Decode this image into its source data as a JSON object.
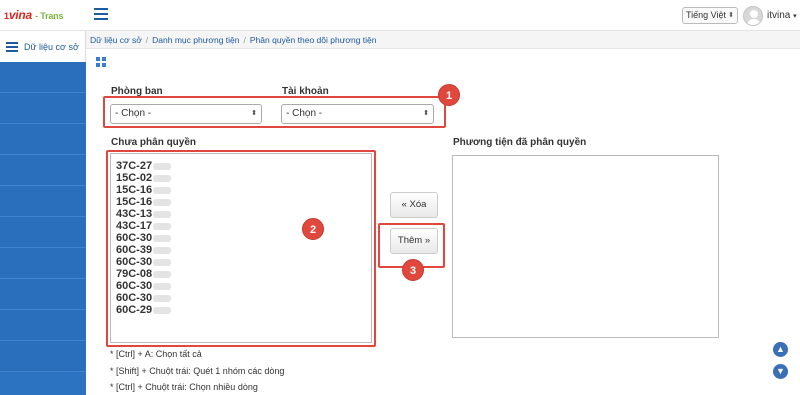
{
  "brand": {
    "prefix": "1",
    "name": "vina",
    "suffix": "- Trans"
  },
  "header": {
    "language": "Tiếng Việt",
    "username": "itvina"
  },
  "sidebar": {
    "active_label": "Dữ liệu cơ sở"
  },
  "breadcrumb": [
    "Dữ liệu cơ sở",
    "Danh mục phương tiện",
    "Phân quyền theo dõi phương tiện"
  ],
  "form": {
    "department_label": "Phòng ban",
    "department_value": "- Chọn -",
    "account_label": "Tài khoản",
    "account_value": "- Chọn -",
    "unassigned_label": "Chưa phân quyền",
    "assigned_label": "Phương tiện đã phân quyền",
    "unassigned_items": [
      "37C-27",
      "15C-02",
      "15C-16",
      "15C-16",
      "43C-13",
      "43C-17",
      "60C-30",
      "60C-39",
      "60C-30",
      "79C-08",
      "60C-30",
      "60C-30",
      "60C-29"
    ],
    "remove_button": "« Xóa",
    "add_button": "Thêm »"
  },
  "hints": [
    "* [Ctrl] + A: Chọn tất cả",
    "* [Shift] + Chuột trái: Quét 1 nhóm các dòng",
    "* [Ctrl] + Chuột trái: Chọn nhiều dòng"
  ],
  "annotations": [
    "1",
    "2",
    "3"
  ],
  "colors": {
    "sidebar": "#2c74c2",
    "accent": "#1e5a9e",
    "annotation": "#e0483d"
  }
}
